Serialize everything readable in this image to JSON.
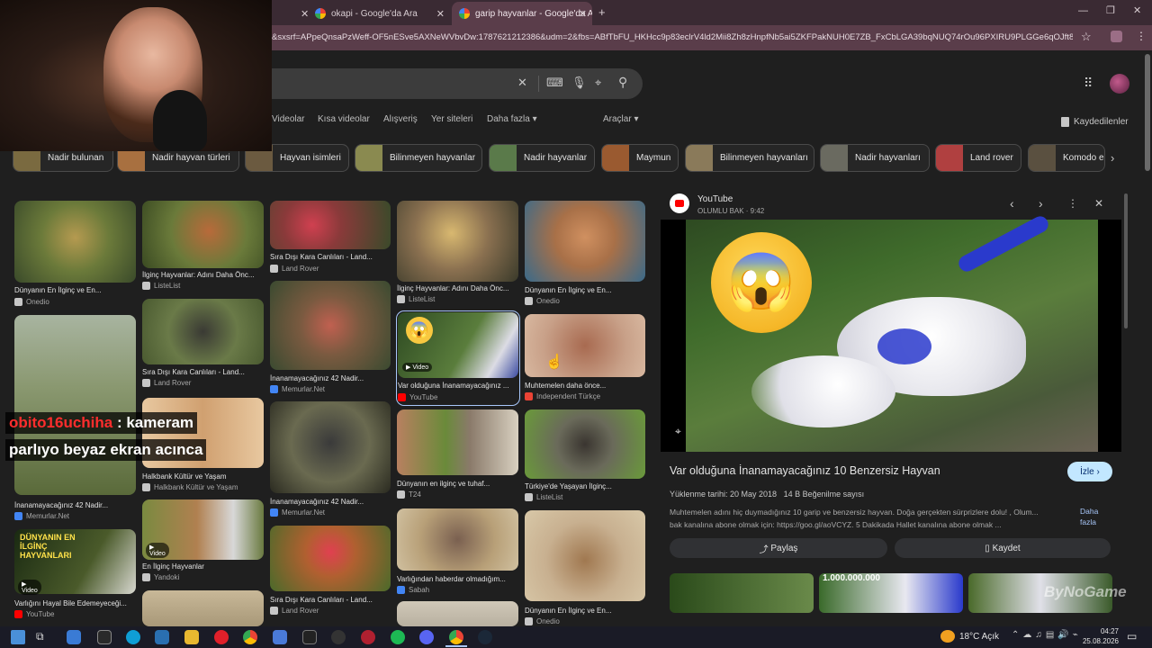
{
  "browser": {
    "tabs": [
      {
        "title": "okapi - Google'da Ara",
        "active": false
      },
      {
        "title": "garip hayvanlar - Google'da Ara",
        "active": true
      }
    ],
    "url": "&sxsrf=APpeQnsaPzWeff-OF5nESve5AXNeWVbvDw:1787621212386&udm=2&fbs=ABfTbFU_HKHcc9p83eclrV4ld2Mii8Zh8zHnpfNb5ai5ZKFPakNUH0E7ZB_FxCbLGA39bqNUQ74rOu96PXIRU9PLGGe6qOJft8cMf-wfA..."
  },
  "google": {
    "nav": [
      "Videolar",
      "Kısa videolar",
      "Alışveriş",
      "Yer siteleri",
      "Daha fazla ▾",
      "Araçlar ▾"
    ],
    "saved_label": "Kaydedilenler",
    "chips": [
      "Nadir bulunan",
      "Nadir hayvan türleri",
      "Hayvan isimleri",
      "Bilinmeyen hayvanlar",
      "Nadir hayvanlar",
      "Maymun",
      "Bilinmeyen hayvanları",
      "Nadir hayvanları",
      "Land rover",
      "Komodo e"
    ]
  },
  "results": {
    "col1": [
      {
        "caption": "Dünyanın En İlginç ve En...",
        "source": "Onedio"
      },
      {
        "caption": "İnanamayacağınız 42 Nadir...",
        "source": "Memurlar.Net"
      },
      {
        "caption": "Varlığını Hayal Bile Edemeyeceği...",
        "source": "YouTube",
        "video": "Video"
      }
    ],
    "col2": [
      {
        "caption": "İlginç Hayvanlar: Adını Daha Önc...",
        "source": "ListeList"
      },
      {
        "caption": "Sıra Dışı Kara Canlıları - Land...",
        "source": "Land Rover"
      },
      {
        "caption": "Halkbank Kültür ve Yaşam",
        "source": "Halkbank Kültür ve Yaşam"
      },
      {
        "caption": "En İlginç Hayvanlar",
        "source": "Yandoki",
        "video": "Video"
      }
    ],
    "col3": [
      {
        "caption": "Sıra Dışı Kara Canlıları - Land...",
        "source": "Land Rover"
      },
      {
        "caption": "İnanamayacağınız 42 Nadir...",
        "source": "Memurlar.Net"
      },
      {
        "caption": "İnanamayacağınız 42 Nadir...",
        "source": "Memurlar.Net"
      },
      {
        "caption": "Sıra Dışı Kara Canlıları - Land...",
        "source": "Land Rover"
      }
    ],
    "col4": [
      {
        "caption": "İlginç Hayvanlar: Adını Daha Önc...",
        "source": "ListeList"
      },
      {
        "caption": "Var olduğuna İnanamayacağınız ...",
        "source": "YouTube",
        "video": "Video"
      },
      {
        "caption": "Dünyanın en ilginç ve tuhaf...",
        "source": "T24"
      },
      {
        "caption": "Varlığından haberdar olmadığım...",
        "source": "Sabah"
      }
    ],
    "col5": [
      {
        "caption": "Dünyanın En İlginç ve En...",
        "source": "Onedio"
      },
      {
        "caption": "Muhtemelen daha önce...",
        "source": "Independent Türkçe"
      },
      {
        "caption": "Türkiye'de Yaşayan İlginç...",
        "source": "ListeList"
      },
      {
        "caption": "Dünyanın En İlginç ve En...",
        "source": "Onedio"
      }
    ]
  },
  "panel": {
    "source": "YouTube",
    "channel": "OLUMLU BAK · 9:42",
    "title": "Var olduğuna İnanamayacağınız 10 Benzersiz Hayvan",
    "watch_label": "İzle",
    "meta": "Yüklenme tarihi: 20 May 2018   14 B Beğenilme sayısı",
    "desc_line1": "Muhtemelen adını hiç duymadığınız 10 garip ve benzersiz hayvan. Doğa gerçekten sürprizlere dolu! , Olum...",
    "desc_line2": "bak kanalına abone olmak için: https://goo.gl/aoVCYZ. 5 Dakikada Hallet kanalına abone olmak ...",
    "more_label": "Daha fazla",
    "share_label": "Paylaş",
    "save_label": "Kaydet",
    "thumb_text": "1.000.000.000"
  },
  "overlay": {
    "chat_user": "obito16uchiha",
    "chat_line1": ": kameram",
    "chat_line2": "parlıyo beyaz ekran acınca",
    "watermark": "ByNoGame",
    "thumb_overlay": "DÜNYANIN EN İLGİNÇ HAYVANLARI"
  },
  "taskbar": {
    "weather": "18°C Açık",
    "time": "04:27",
    "date": "25.08.2026"
  },
  "colors": {
    "accent_blue": "#a8c7fa",
    "watch_bg": "#c2e7ff",
    "youtube_red": "#ff0000"
  }
}
